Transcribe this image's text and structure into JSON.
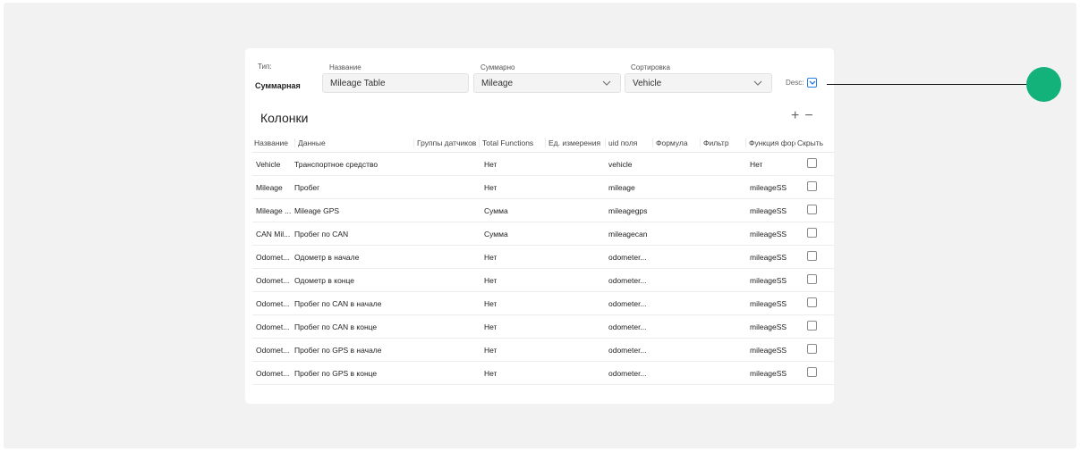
{
  "form": {
    "type_label": "Тип:",
    "type_value": "Суммарная",
    "name_label": "Название",
    "name_value": "Mileage Table",
    "summary_label": "Суммарно",
    "summary_value": "Mileage",
    "sort_label": "Сортировка",
    "sort_value": "Vehicle",
    "desc_label": "Desc:",
    "desc_checked": true
  },
  "columns_section": {
    "title": "Колонки",
    "add_label": "+",
    "remove_label": "−"
  },
  "table": {
    "headers": [
      "Название",
      "Данные",
      "Группы датчиков",
      "Total Functions",
      "Ед. измерения",
      "uid поля",
      "Формула",
      "Фильтр",
      "Функция форматирования",
      "Скрыть"
    ],
    "rows": [
      {
        "name": "Vehicle",
        "data": "Транспортное средство",
        "total": "Нет",
        "uid": "vehicle",
        "func": "Нет"
      },
      {
        "name": "Mileage",
        "data": "Пробег",
        "total": "Нет",
        "uid": "mileage",
        "func": "mileageSS"
      },
      {
        "name": "Mileage ...",
        "data": "Mileage GPS",
        "total": "Сумма",
        "uid": "mileagegps",
        "func": "mileageSS"
      },
      {
        "name": "CAN Mil...",
        "data": "Пробег по CAN",
        "total": "Сумма",
        "uid": "mileagecan",
        "func": "mileageSS"
      },
      {
        "name": "Odomet...",
        "data": "Одометр в начале",
        "total": "Нет",
        "uid": "odometer...",
        "func": "mileageSS"
      },
      {
        "name": "Odomet...",
        "data": "Одометр в конце",
        "total": "Нет",
        "uid": "odometer...",
        "func": "mileageSS"
      },
      {
        "name": "Odomet...",
        "data": "Пробег по CAN в начале",
        "total": "Нет",
        "uid": "odometer...",
        "func": "mileageSS"
      },
      {
        "name": "Odomet...",
        "data": "Пробег по CAN в конце",
        "total": "Нет",
        "uid": "odometer...",
        "func": "mileageSS"
      },
      {
        "name": "Odomet...",
        "data": "Пробег по GPS в начале",
        "total": "Нет",
        "uid": "odometer...",
        "func": "mileageSS"
      },
      {
        "name": "Odomet...",
        "data": "Пробег по GPS в конце",
        "total": "Нет",
        "uid": "odometer...",
        "func": "mileageSS"
      }
    ]
  },
  "colors": {
    "accent": "#2a7de1",
    "marker": "#13b27a",
    "frame_bg": "#f2f2f2"
  }
}
